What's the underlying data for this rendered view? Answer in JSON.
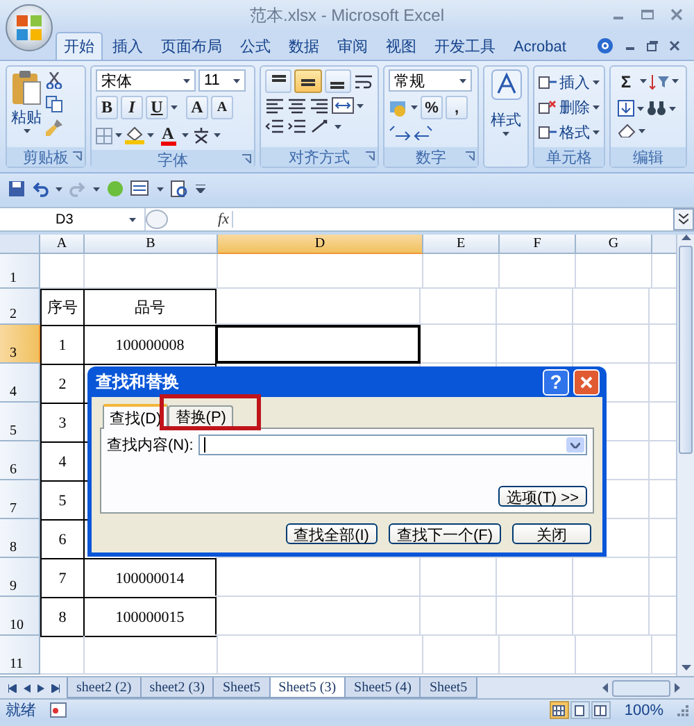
{
  "window": {
    "title": "范本.xlsx - Microsoft Excel"
  },
  "ribbon_tabs": [
    {
      "label": "开始",
      "selected": true
    },
    {
      "label": "插入",
      "selected": false
    },
    {
      "label": "页面布局",
      "selected": false
    },
    {
      "label": "公式",
      "selected": false
    },
    {
      "label": "数据",
      "selected": false
    },
    {
      "label": "审阅",
      "selected": false
    },
    {
      "label": "视图",
      "selected": false
    },
    {
      "label": "开发工具",
      "selected": false
    },
    {
      "label": "Acrobat",
      "selected": false
    }
  ],
  "clipboard": {
    "label": "剪贴板",
    "paste": "粘贴"
  },
  "font": {
    "label": "字体",
    "font_name": "宋体",
    "font_size": "11",
    "bold": "B",
    "italic": "I",
    "underline": "U",
    "grow": "A",
    "shrink": "A",
    "font_color": "A"
  },
  "alignment": {
    "label": "对齐方式",
    "vertical": [
      {
        "selected": false
      },
      {
        "selected": true
      },
      {
        "selected": false
      }
    ]
  },
  "number": {
    "label": "数字",
    "format": "常规",
    "percent": "%",
    "comma": ","
  },
  "styles": {
    "button": "样式"
  },
  "cells": {
    "label": "单元格",
    "buttons": [
      "插入",
      "删除",
      "格式"
    ]
  },
  "editing": {
    "label": "编辑",
    "sum": "Σ"
  },
  "formula_bar": {
    "name_box": "D3",
    "fx": "fx"
  },
  "sheet": {
    "columns": [
      {
        "label": "A",
        "selected": false
      },
      {
        "label": "B",
        "selected": false
      },
      {
        "label": "D",
        "selected": true
      },
      {
        "label": "E",
        "selected": false
      },
      {
        "label": "F",
        "selected": false
      },
      {
        "label": "G",
        "selected": false
      }
    ],
    "rows": [
      {
        "number": "1",
        "selected": false
      },
      {
        "number": "2",
        "selected": false,
        "cells": [
          "序号",
          "品号"
        ]
      },
      {
        "number": "3",
        "selected": true,
        "cells": [
          "1",
          "100000008"
        ]
      },
      {
        "number": "4",
        "selected": false,
        "cells": [
          "2"
        ]
      },
      {
        "number": "5",
        "selected": false,
        "cells": [
          "3"
        ]
      },
      {
        "number": "6",
        "selected": false,
        "cells": [
          "4"
        ]
      },
      {
        "number": "7",
        "selected": false,
        "cells": [
          "5"
        ]
      },
      {
        "number": "8",
        "selected": false,
        "cells": [
          "6"
        ]
      },
      {
        "number": "9",
        "selected": false,
        "cells": [
          "7",
          "100000014"
        ]
      },
      {
        "number": "10",
        "selected": false,
        "cells": [
          "8",
          "100000015"
        ]
      },
      {
        "number": "11",
        "selected": false
      }
    ]
  },
  "dialog": {
    "title": "查找和替换",
    "help": "?",
    "tabs": [
      {
        "label": "查找(D)",
        "selected": true,
        "highlighted": false
      },
      {
        "label": "替换(P)",
        "selected": false,
        "highlighted": true
      }
    ],
    "find_label": "查找内容(N):",
    "options": "选项(T) >>",
    "buttons": [
      "查找全部(I)",
      "查找下一个(F)",
      "关闭"
    ]
  },
  "sheet_tabs": [
    {
      "label": "sheet2 (2)",
      "selected": false
    },
    {
      "label": "sheet2 (3)",
      "selected": false
    },
    {
      "label": "Sheet5",
      "selected": false
    },
    {
      "label": "Sheet5 (3)",
      "selected": true
    },
    {
      "label": "Sheet5 (4)",
      "selected": false
    },
    {
      "label": "Sheet5",
      "selected": false
    }
  ],
  "status_bar": {
    "status": "就绪",
    "views": [
      {
        "selected": true
      },
      {
        "selected": false
      },
      {
        "selected": false
      }
    ],
    "zoom": "100%"
  }
}
